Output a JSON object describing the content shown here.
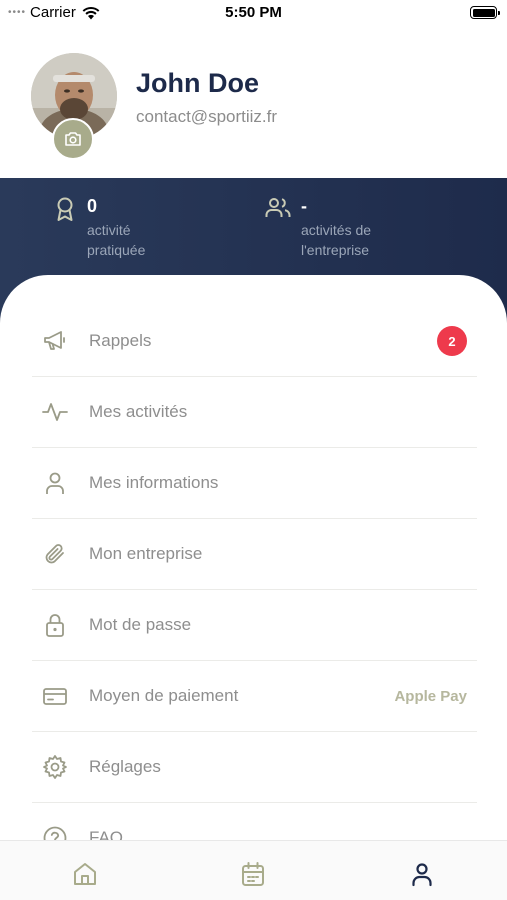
{
  "status_bar": {
    "carrier": "Carrier",
    "time": "5:50 PM"
  },
  "profile": {
    "name": "John Doe",
    "email": "contact@sportiiz.fr"
  },
  "stats": [
    {
      "icon": "award-icon",
      "value": "0",
      "label": "activité\npratiquée"
    },
    {
      "icon": "users-icon",
      "value": "-",
      "label": "activités de\nl'entreprise"
    }
  ],
  "menu": {
    "items": [
      {
        "icon": "megaphone-icon",
        "label": "Rappels",
        "badge": "2"
      },
      {
        "icon": "activity-icon",
        "label": "Mes activités"
      },
      {
        "icon": "user-icon",
        "label": "Mes informations"
      },
      {
        "icon": "paperclip-icon",
        "label": "Mon entreprise"
      },
      {
        "icon": "lock-icon",
        "label": "Mot de passe"
      },
      {
        "icon": "credit-card-icon",
        "label": "Moyen de paiement",
        "value": "Apple Pay"
      },
      {
        "icon": "gear-icon",
        "label": "Réglages"
      },
      {
        "icon": "help-circle-icon",
        "label": "FAQ"
      }
    ]
  },
  "tab_bar": {
    "tabs": [
      {
        "icon": "home-icon",
        "active": false
      },
      {
        "icon": "calendar-icon",
        "active": false
      },
      {
        "icon": "profile-icon",
        "active": true
      }
    ]
  },
  "colors": {
    "navy": "#1d2a4a",
    "accent_olive": "#a8ab8b",
    "badge_red": "#ee3a4c",
    "menu_text": "#8e8e8e",
    "icon_olive": "#9a9b88"
  }
}
